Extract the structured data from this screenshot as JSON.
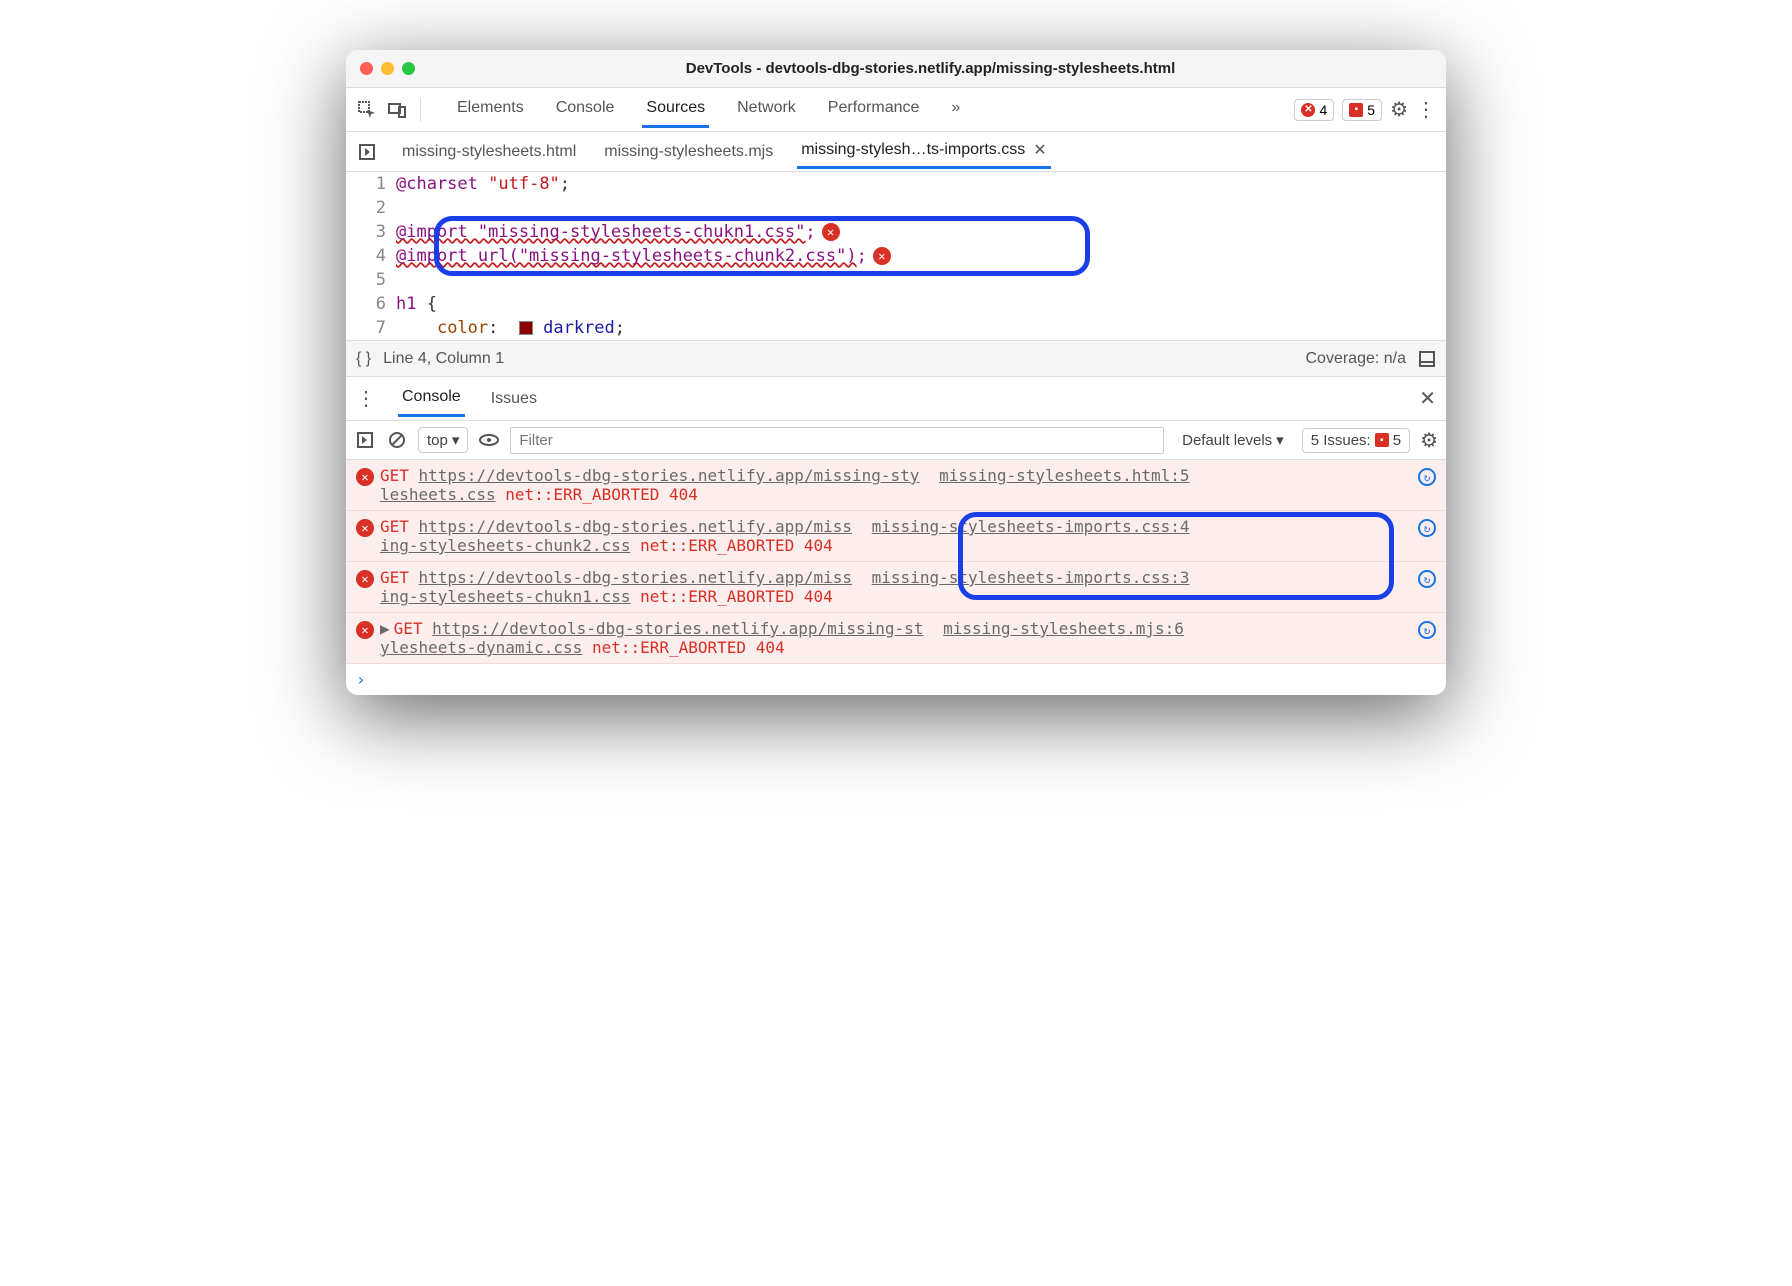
{
  "window": {
    "title": "DevTools - devtools-dbg-stories.netlify.app/missing-stylesheets.html"
  },
  "toolbar": {
    "tabs": [
      "Elements",
      "Console",
      "Sources",
      "Network",
      "Performance"
    ],
    "active": "Sources",
    "more": "»",
    "error_count": "4",
    "issue_count": "5"
  },
  "files": {
    "tabs": [
      {
        "label": "missing-stylesheets.html"
      },
      {
        "label": "missing-stylesheets.mjs"
      },
      {
        "label": "missing-stylesh…ts-imports.css",
        "active": true
      }
    ]
  },
  "code": {
    "lines": [
      {
        "n": "1",
        "html": "<span class='kw'>@charset</span> <span class='str'>\"utf-8\"</span>;"
      },
      {
        "n": "2",
        "html": ""
      },
      {
        "n": "3",
        "html": "<span class='kw strdec'>@import \"missing-stylesheets-chukn1.css\"</span><span class='kw'>;</span><span class='err-dot'>✕</span>"
      },
      {
        "n": "4",
        "html": "<span class='kw strdec'>@import url(\"missing-stylesheets-chunk2.css\")</span><span class='kw'>;</span><span class='err-dot'>✕</span>"
      },
      {
        "n": "5",
        "html": ""
      },
      {
        "n": "6",
        "html": "<span class='fn'>h1</span> {"
      },
      {
        "n": "7",
        "html": "    <span class='prop'>color</span>:  <span class='swatch'></span> <span class='col'>darkred</span>;"
      }
    ]
  },
  "status": {
    "cursor": "Line 4, Column 1",
    "coverage": "Coverage: n/a"
  },
  "drawer": {
    "tabs": [
      "Console",
      "Issues"
    ],
    "active": "Console"
  },
  "console_toolbar": {
    "context": "top",
    "filter_placeholder": "Filter",
    "levels": "Default levels",
    "issues_label": "5 Issues:",
    "issues_count": "5"
  },
  "console": [
    {
      "method": "GET",
      "url": "https://devtools-dbg-stories.netlify.app/missing-stylesheets.css",
      "url_break": "https://devtools-dbg-stories.netlify.app/missing-sty lesheets.css",
      "status": "net::ERR_ABORTED 404",
      "source": "missing-stylesheets.html:5"
    },
    {
      "method": "GET",
      "url": "https://devtools-dbg-stories.netlify.app/missing-stylesheets-chunk2.css",
      "url_break": "https://devtools-dbg-stories.netlify.app/miss ing-stylesheets-chunk2.css",
      "status": "net::ERR_ABORTED 404",
      "source": "missing-stylesheets-imports.css:4"
    },
    {
      "method": "GET",
      "url": "https://devtools-dbg-stories.netlify.app/missing-stylesheets-chukn1.css",
      "url_break": "https://devtools-dbg-stories.netlify.app/miss ing-stylesheets-chukn1.css",
      "status": "net::ERR_ABORTED 404",
      "source": "missing-stylesheets-imports.css:3"
    },
    {
      "method": "GET",
      "expand": true,
      "url": "https://devtools-dbg-stories.netlify.app/missing-stylesheets-dynamic.css",
      "url_break": "https://devtools-dbg-stories.netlify.app/missing-st ylesheets-dynamic.css",
      "status": "net::ERR_ABORTED 404",
      "source": "missing-stylesheets.mjs:6"
    }
  ]
}
